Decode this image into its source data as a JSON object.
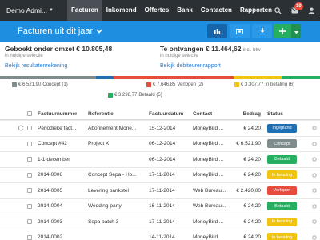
{
  "nav": {
    "brand": "Demo Admi...",
    "items": [
      {
        "label": "Facturen",
        "active": true
      },
      {
        "label": "Inkomend",
        "active": false
      },
      {
        "label": "Offertes",
        "active": false
      },
      {
        "label": "Bank",
        "active": false
      },
      {
        "label": "Contacten",
        "active": false
      },
      {
        "label": "Rapporten",
        "active": false
      }
    ],
    "notification_count": "10",
    "icons": [
      "search-icon",
      "notifications-icon",
      "user-icon"
    ]
  },
  "page": {
    "title": "Facturen uit dit jaar",
    "toolbar_icons": [
      "bar-chart-icon",
      "money-icon",
      "download-icon",
      "plus-icon",
      "caret-down-icon"
    ]
  },
  "summary": {
    "revenue_label": "Geboekt onder omzet",
    "revenue_value": "€ 10.805,48",
    "revenue_sub": "in huidige selectie",
    "revenue_link": "Bekijk resultatenrekening",
    "receivable_label": "Te ontvangen",
    "receivable_value": "€ 11.464,62",
    "receivable_suffix": "incl. btw",
    "receivable_sub": "in huidige selectie",
    "receivable_link": "Bekijk debiteurenrapport"
  },
  "legend": [
    {
      "amount": "€ 6.521,90",
      "label": "Concept (1)",
      "color": "#7f8c8d"
    },
    {
      "amount": "€ 7.646,85",
      "label": "Verlopen (2)",
      "color": "#e74c3c"
    },
    {
      "amount": "€ 3.307,77",
      "label": "In betaling (6)",
      "color": "#f1c40f"
    },
    {
      "amount": "€ 3.298,77",
      "label": "Betaald (5)",
      "color": "#27ae60"
    }
  ],
  "colors": {
    "nav_bg": "#2b3034",
    "title_bg": "#1e8fe0",
    "link": "#2a7ccf",
    "bar_concept": "#7f8c8d",
    "bar_ingepland": "#1f6fb3",
    "bar_verlopen": "#e74c3c",
    "bar_in_betaling": "#f1c40f",
    "bar_betaald": "#27ae60",
    "btn_primary": "#1764a8",
    "btn_add": "#27ae60"
  },
  "table": {
    "headers": [
      "Factuurnummer",
      "Referentie",
      "Factuurdatum",
      "Contact",
      "Bedrag",
      "Status"
    ],
    "rows": [
      {
        "number": "Periodieke fact...",
        "reference": "Abonnement Mone...",
        "date": "15-12-2014",
        "contact": "MoneyBird ...",
        "amount": "€ 24,20",
        "status": "Ingepland",
        "status_color": "#1f6fb3",
        "recurring": true
      },
      {
        "number": "Concept #42",
        "reference": "Project X",
        "date": "06-12-2014",
        "contact": "MoneyBird ...",
        "amount": "€ 6.521,90",
        "status": "Concept",
        "status_color": "#7f8c8d",
        "recurring": false
      },
      {
        "number": "1-1-december",
        "reference": "",
        "date": "06-12-2014",
        "contact": "MoneyBird ...",
        "amount": "€ 24,20",
        "status": "Betaald",
        "status_color": "#27ae60",
        "recurring": false
      },
      {
        "number": "2014-0006",
        "reference": "Concept Sepa - Ho...",
        "date": "17-11-2014",
        "contact": "MoneyBird ...",
        "amount": "€ 24,20",
        "status": "In betaling",
        "status_color": "#f1c40f",
        "recurring": false
      },
      {
        "number": "2014-0005",
        "reference": "Levering bankstel",
        "date": "17-11-2014",
        "contact": "Web Bureau...",
        "amount": "€ 2.420,00",
        "status": "Verlopen",
        "status_color": "#e74c3c",
        "recurring": false
      },
      {
        "number": "2014-0004",
        "reference": "Wedding party",
        "date": "16-11-2014",
        "contact": "Web Bureau...",
        "amount": "€ 24,20",
        "status": "Betaald",
        "status_color": "#27ae60",
        "recurring": false
      },
      {
        "number": "2014-0003",
        "reference": "Sepa batch 3",
        "date": "17-11-2014",
        "contact": "MoneyBird ...",
        "amount": "€ 24,20",
        "status": "In betaling",
        "status_color": "#f1c40f",
        "recurring": false
      },
      {
        "number": "2014-0002",
        "reference": "",
        "date": "14-11-2014",
        "contact": "MoneyBird ...",
        "amount": "€ 24,20",
        "status": "In betaling",
        "status_color": "#f1c40f",
        "recurring": false
      }
    ]
  }
}
